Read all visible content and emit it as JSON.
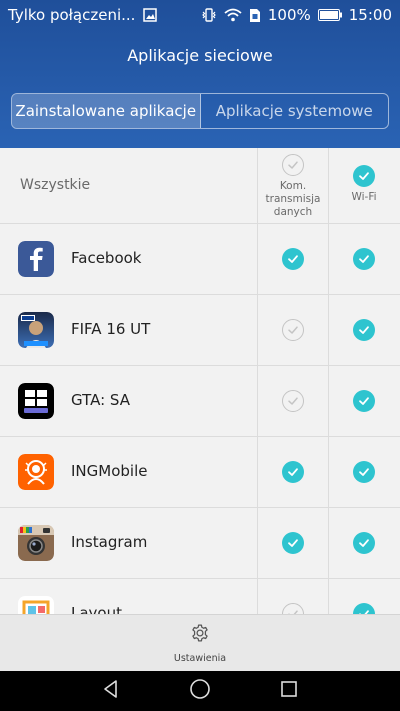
{
  "status_bar": {
    "notification": "Tylko połączeni...",
    "battery": "100%",
    "time": "15:00"
  },
  "header": {
    "title": "Aplikacje sieciowe",
    "tabs": [
      {
        "label": "Zainstalowane aplikacje",
        "active": true
      },
      {
        "label": "Aplikacje systemowe",
        "active": false
      }
    ]
  },
  "list": {
    "all_label": "Wszystkie",
    "columns": {
      "mobile": {
        "label": "Kom. transmisja danych",
        "all_checked": false
      },
      "wifi": {
        "label": "Wi-Fi",
        "all_checked": true
      }
    },
    "apps": [
      {
        "name": "Facebook",
        "mobile": true,
        "wifi": true
      },
      {
        "name": "FIFA 16 UT",
        "mobile": false,
        "wifi": true
      },
      {
        "name": "GTA: SA",
        "mobile": false,
        "wifi": true
      },
      {
        "name": "INGMobile",
        "mobile": true,
        "wifi": true
      },
      {
        "name": "Instagram",
        "mobile": true,
        "wifi": true
      },
      {
        "name": "Layout",
        "mobile": false,
        "wifi": true
      }
    ]
  },
  "bottom_bar": {
    "settings_label": "Ustawienia"
  },
  "colors": {
    "header": "#2a63b4",
    "accent": "#2ec4cf"
  }
}
